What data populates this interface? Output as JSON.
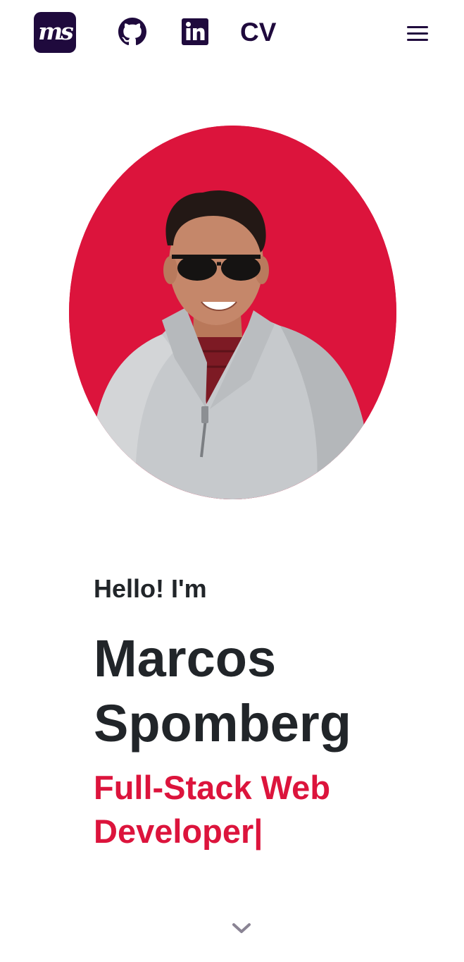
{
  "nav": {
    "logo_text": "ms",
    "cv_label": "CV",
    "icons": [
      "github-icon",
      "linkedin-icon",
      "hamburger-menu-icon"
    ]
  },
  "hero": {
    "greeting": "Hello! I'm",
    "name_first": "Marcos",
    "name_last": "Spomberg",
    "role_line1": "Full-Stack Web",
    "role_line2": "Developer|"
  },
  "colors": {
    "brand_dark": "#1f0a3d",
    "accent_red": "#dc143c",
    "text_dark": "#212529",
    "chevron": "#8a8494"
  }
}
